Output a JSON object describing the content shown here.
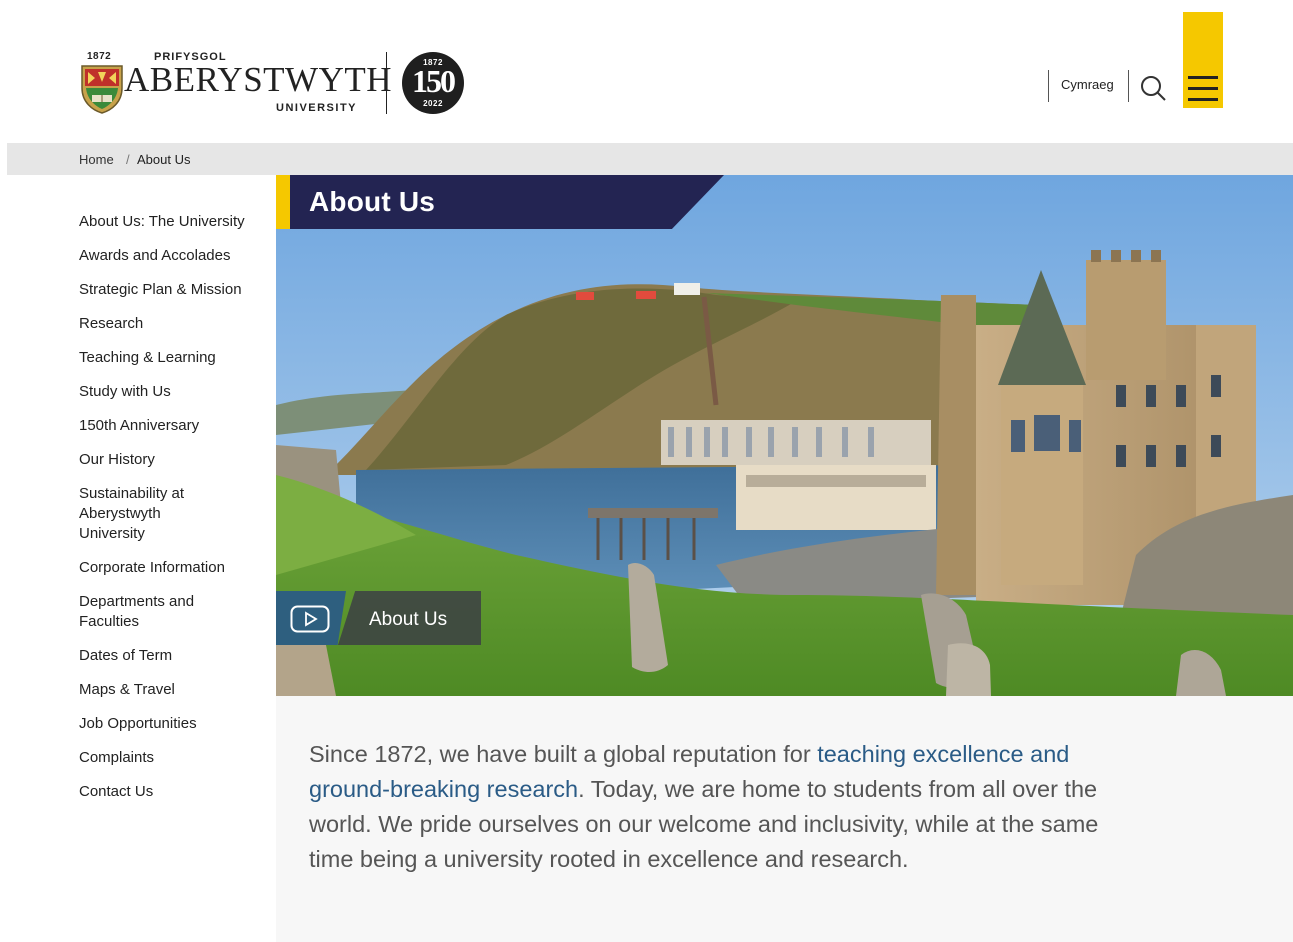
{
  "header": {
    "logo": {
      "year": "1872",
      "prifysgol": "PRIFYSGOL",
      "wordmark": "ABERYSTWYTH",
      "university": "UNIVERSITY",
      "badge_top": "1872",
      "badge_number": "150",
      "badge_bottom": "2022"
    },
    "language_link": "Cymraeg",
    "search_icon": "search-icon",
    "menu_icon": "hamburger-menu-icon",
    "accent_color": "#f5c800"
  },
  "breadcrumb": {
    "home": "Home",
    "separator": "/",
    "current": "About Us"
  },
  "sidebar": {
    "items": [
      {
        "label": "About Us: The University"
      },
      {
        "label": "Awards and Accolades"
      },
      {
        "label": "Strategic Plan & Mission"
      },
      {
        "label": "Research"
      },
      {
        "label": "Teaching & Learning"
      },
      {
        "label": "Study with Us"
      },
      {
        "label": "150th Anniversary"
      },
      {
        "label": "Our History"
      },
      {
        "label": "Sustainability at Aberystwyth University"
      },
      {
        "label": "Corporate Information"
      },
      {
        "label": "Departments and Faculties"
      },
      {
        "label": "Dates of Term"
      },
      {
        "label": "Maps & Travel"
      },
      {
        "label": "Job Opportunities"
      },
      {
        "label": "Complaints"
      },
      {
        "label": "Contact Us"
      }
    ]
  },
  "hero": {
    "title": "About Us",
    "title_band_color": "#232452",
    "video_button_label": "About Us",
    "video_icon": "play-icon"
  },
  "intro": {
    "before": "Since 1872, we have built a global reputation for ",
    "link": "teaching excellence and ground-breaking research",
    "after": ". Today, we are home to students from all over the world. We pride ourselves on our welcome and inclusivity, while at the same time being a university rooted in excellence and research.",
    "link_color": "#2a5b86"
  }
}
